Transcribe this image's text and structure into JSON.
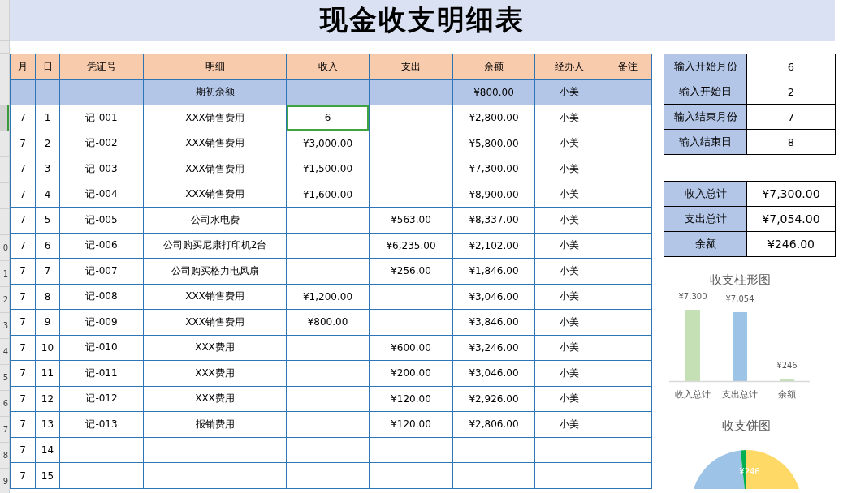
{
  "title": "现金收支明细表",
  "table": {
    "columns": [
      "月",
      "日",
      "凭证号",
      "明细",
      "收入",
      "支出",
      "余额",
      "经办人",
      "备注"
    ],
    "opening_row": {
      "label": "期初余额",
      "balance": "¥800.00",
      "handler": "小美"
    },
    "rows": [
      {
        "month": "7",
        "day": "1",
        "voucher": "记-001",
        "detail": "XXX销售费用",
        "income": "6",
        "expense": "",
        "balance": "¥2,800.00",
        "handler": "小美",
        "selected": true
      },
      {
        "month": "7",
        "day": "2",
        "voucher": "记-002",
        "detail": "XXX销售费用",
        "income": "¥3,000.00",
        "expense": "",
        "balance": "¥5,800.00",
        "handler": "小美",
        "selected": false
      },
      {
        "month": "7",
        "day": "3",
        "voucher": "记-003",
        "detail": "XXX销售费用",
        "income": "¥1,500.00",
        "expense": "",
        "balance": "¥7,300.00",
        "handler": "小美",
        "selected": false
      },
      {
        "month": "7",
        "day": "4",
        "voucher": "记-004",
        "detail": "XXX销售费用",
        "income": "¥1,600.00",
        "expense": "",
        "balance": "¥8,900.00",
        "handler": "小美",
        "selected": false
      },
      {
        "month": "7",
        "day": "5",
        "voucher": "记-005",
        "detail": "公司水电费",
        "income": "",
        "expense": "¥563.00",
        "balance": "¥8,337.00",
        "handler": "小美",
        "selected": false
      },
      {
        "gutter": "0",
        "month": "7",
        "day": "6",
        "voucher": "记-006",
        "detail": "公司购买尼康打印机2台",
        "income": "",
        "expense": "¥6,235.00",
        "balance": "¥2,102.00",
        "handler": "小美",
        "selected": false
      },
      {
        "gutter": "1",
        "month": "7",
        "day": "7",
        "voucher": "记-007",
        "detail": "公司购买格力电风扇",
        "income": "",
        "expense": "¥256.00",
        "balance": "¥1,846.00",
        "handler": "小美",
        "selected": false
      },
      {
        "gutter": "2",
        "month": "7",
        "day": "8",
        "voucher": "记-008",
        "detail": "XXX销售费用",
        "income": "¥1,200.00",
        "expense": "",
        "balance": "¥3,046.00",
        "handler": "小美",
        "selected": false
      },
      {
        "gutter": "3",
        "month": "7",
        "day": "9",
        "voucher": "记-009",
        "detail": "XXX销售费用",
        "income": "¥800.00",
        "expense": "",
        "balance": "¥3,846.00",
        "handler": "小美",
        "selected": false
      },
      {
        "gutter": "4",
        "month": "7",
        "day": "10",
        "voucher": "记-010",
        "detail": "XXX费用",
        "income": "",
        "expense": "¥600.00",
        "balance": "¥3,246.00",
        "handler": "小美",
        "selected": false
      },
      {
        "gutter": "5",
        "month": "7",
        "day": "11",
        "voucher": "记-011",
        "detail": "XXX费用",
        "income": "",
        "expense": "¥200.00",
        "balance": "¥3,046.00",
        "handler": "小美",
        "selected": false
      },
      {
        "gutter": "6",
        "month": "7",
        "day": "12",
        "voucher": "记-012",
        "detail": "XXX费用",
        "income": "",
        "expense": "¥120.00",
        "balance": "¥2,926.00",
        "handler": "小美",
        "selected": false
      },
      {
        "gutter": "7",
        "month": "7",
        "day": "13",
        "voucher": "记-013",
        "detail": "报销费用",
        "income": "",
        "expense": "¥120.00",
        "balance": "¥2,806.00",
        "handler": "小美",
        "selected": false
      },
      {
        "gutter": "8",
        "month": "7",
        "day": "14",
        "voucher": "",
        "detail": "",
        "income": "",
        "expense": "",
        "balance": "",
        "handler": "",
        "selected": false
      },
      {
        "gutter": "9",
        "month": "7",
        "day": "15",
        "voucher": "",
        "detail": "",
        "income": "",
        "expense": "",
        "balance": "",
        "handler": "",
        "selected": false
      }
    ]
  },
  "filters": [
    {
      "label": "输入开始月份",
      "value": "6"
    },
    {
      "label": "输入开始日",
      "value": "2"
    },
    {
      "label": "输入结束月份",
      "value": "7"
    },
    {
      "label": "输入结束日",
      "value": "8"
    }
  ],
  "totals": [
    {
      "label": "收入总计",
      "value": "¥7,300.00"
    },
    {
      "label": "支出总计",
      "value": "¥7,054.00"
    },
    {
      "label": "余额",
      "value": "¥246.00"
    }
  ],
  "bar_chart": {
    "chart_data": {
      "type": "bar",
      "title": "收支柱形图",
      "categories": [
        "收入总计",
        "支出总计",
        "余额"
      ],
      "values": [
        7300,
        7054,
        246
      ],
      "value_labels": [
        "¥7,300",
        "¥7,054",
        "¥246"
      ]
    }
  },
  "pie_chart": {
    "chart_data": {
      "type": "pie",
      "title": "收支饼图",
      "values": [
        7300,
        7054,
        246
      ],
      "value_labels": [
        null,
        null,
        "¥246"
      ]
    }
  }
}
